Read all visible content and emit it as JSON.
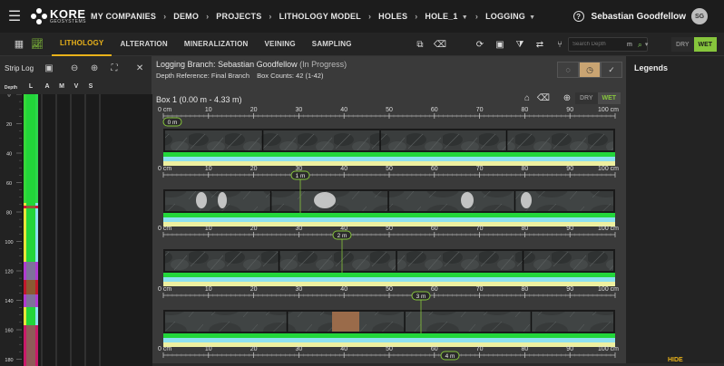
{
  "topbar": {
    "logo_main": "KORE",
    "logo_sub": "GEOSYSTEMS",
    "crumbs": [
      "MY COMPANIES",
      "DEMO",
      "PROJECTS",
      "LITHOLOGY MODEL",
      "HOLES",
      "HOLE_1",
      "LOGGING"
    ],
    "user_name": "Sebastian Goodfellow",
    "user_initials": "SG",
    "help_glyph": "?"
  },
  "tabs": [
    "LITHOLOGY",
    "ALTERATION",
    "MINERALIZATION",
    "VEINING",
    "SAMPLING"
  ],
  "search": {
    "placeholder": "Search Depth",
    "unit": "m"
  },
  "drywet": {
    "dry": "DRY",
    "wet": "WET"
  },
  "strip_log": {
    "title": "Strip Log",
    "columns": [
      "Depth",
      "L",
      "A",
      "M",
      "V",
      "S"
    ],
    "depth_ticks": [
      "0",
      "20",
      "40",
      "60",
      "80",
      "100",
      "120",
      "140",
      "160",
      "180"
    ]
  },
  "logging": {
    "branch_label": "Logging Branch:",
    "branch_name": "Sebastian Goodfellow",
    "branch_status": "(In Progress)",
    "depth_ref_label": "Depth Reference:",
    "depth_ref_value": "Final Branch",
    "box_counts_label": "Box Counts:",
    "box_counts_value": "42 (1-42)",
    "box_title": "Box 1 (0.00 m - 4.33 m)",
    "dry": "DRY",
    "wet": "WET"
  },
  "ruler": {
    "ticks": [
      "0 cm",
      "10",
      "20",
      "30",
      "40",
      "50",
      "60",
      "70",
      "80",
      "90",
      "100 cm"
    ],
    "markers": [
      "0 m",
      "1 m",
      "2 m",
      "3 m",
      "4 m"
    ]
  },
  "legends": {
    "title": "Legends",
    "hide": "HIDE"
  },
  "colors": {
    "accent": "#e9b21a",
    "wet_green": "#86c53c",
    "lith_green": "#22d63a",
    "lith_cyan": "#8de0f0",
    "lith_yellow": "#eef0a0"
  }
}
